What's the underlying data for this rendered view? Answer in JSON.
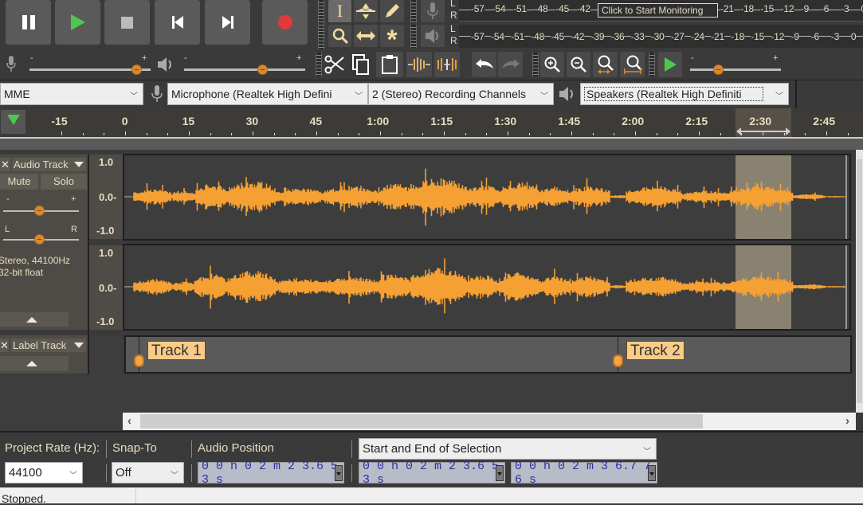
{
  "transport": {
    "buttons": [
      {
        "name": "pause-button",
        "icon": "pause-icon"
      },
      {
        "name": "play-button",
        "icon": "play-icon"
      },
      {
        "name": "stop-button",
        "icon": "stop-icon"
      },
      {
        "name": "skip-to-start-button",
        "icon": "skip-start-icon"
      },
      {
        "name": "skip-to-end-button",
        "icon": "skip-end-icon"
      },
      {
        "name": "record-button",
        "icon": "record-icon"
      }
    ],
    "colors": {
      "play": "#4cc94c",
      "record": "#e03a3a"
    }
  },
  "tools": [
    {
      "name": "selection-tool",
      "icon": "ibeam-icon",
      "active": true
    },
    {
      "name": "envelope-tool",
      "icon": "envelope-icon"
    },
    {
      "name": "draw-tool",
      "icon": "pencil-icon"
    },
    {
      "name": "zoom-tool",
      "icon": "magnifier-icon"
    },
    {
      "name": "time-shift-tool",
      "icon": "double-arrow-icon"
    },
    {
      "name": "multi-tool",
      "icon": "asterisk-icon"
    }
  ],
  "meters": {
    "record_scale": [
      "-57",
      "-54",
      "-51",
      "-48",
      "-45",
      "-42",
      "-3",
      "-21",
      "-18",
      "-15",
      "-12",
      "-9",
      "-6",
      "-3",
      "0"
    ],
    "playback_scale": [
      "-57",
      "-54",
      "-51",
      "-48",
      "-45",
      "-42",
      "-39",
      "-36",
      "-33",
      "-30",
      "-27",
      "-24",
      "-21",
      "-18",
      "-15",
      "-12",
      "-9",
      "-6",
      "-3",
      "0"
    ],
    "channels": [
      "L",
      "R"
    ],
    "monitor_tooltip": "Click to Start Monitoring"
  },
  "mixer": {
    "recording_volume": 0.85,
    "playback_volume": 0.7,
    "minus": "-",
    "plus": "+"
  },
  "edit": {
    "buttons": [
      "cut",
      "copy",
      "paste",
      "trim",
      "silence",
      "undo",
      "redo"
    ]
  },
  "view": {
    "buttons": [
      "zoom-in",
      "zoom-out",
      "fit-selection",
      "fit-project"
    ],
    "play_at_speed": 0.3
  },
  "device": {
    "host": "MME",
    "mic": "Microphone (Realtek High Defini",
    "channels": "2 (Stereo) Recording Channels",
    "speaker": "Speakers (Realtek High Definiti"
  },
  "ruler": {
    "labels": [
      "-15",
      "0",
      "15",
      "30",
      "45",
      "1:00",
      "1:15",
      "1:30",
      "1:45",
      "2:00",
      "2:15",
      "2:30",
      "2:45"
    ]
  },
  "audio_track": {
    "name": "Audio Track",
    "mute": "Mute",
    "solo": "Solo",
    "gain": 0.5,
    "pan": 0.5,
    "pan_left": "L",
    "pan_right": "R",
    "info_line1": "Stereo, 44100Hz",
    "info_line2": "32-bit float",
    "scale": [
      "1.0",
      "0.0-",
      "-1.0"
    ],
    "wave_color": "#f5a033"
  },
  "label_track": {
    "name": "Label Track",
    "labels": [
      {
        "text": "Track 1",
        "time": "0:00"
      },
      {
        "text": "Track 2",
        "time": "2:00"
      }
    ]
  },
  "selection_toolbar": {
    "project_rate_label": "Project Rate (Hz):",
    "project_rate": "44100",
    "snap_to_label": "Snap-To",
    "snap_to": "Off",
    "audio_position_label": "Audio Position",
    "audio_position": "0 0 h 0 2 m 2 3.6 5 3 s",
    "selection_mode": "Start and End of Selection",
    "selection_start": "0 0 h 0 2 m 2 3.6 5 3 s",
    "selection_end": "0 0 h 0 2 m 3 6.7 7 6 s"
  },
  "status": {
    "text": "Stopped."
  }
}
